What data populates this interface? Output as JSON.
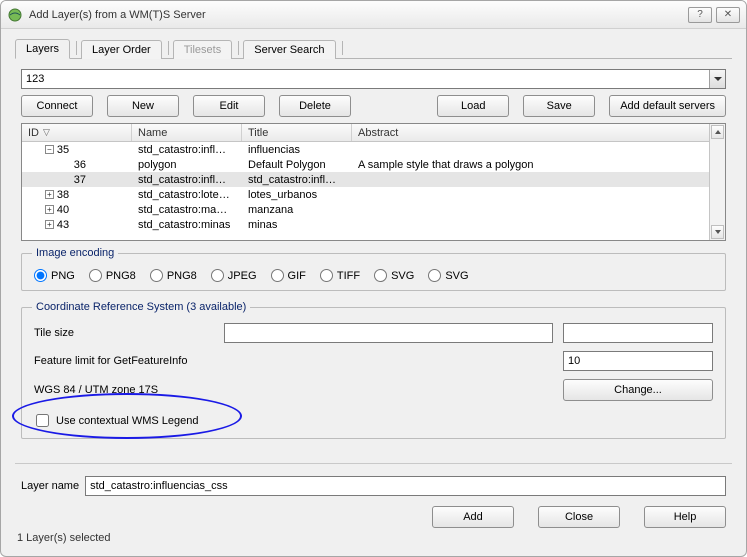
{
  "window": {
    "title": "Add Layer(s) from a WM(T)S Server"
  },
  "tabs": {
    "layers": "Layers",
    "layer_order": "Layer Order",
    "tilesets": "Tilesets",
    "server_search": "Server Search"
  },
  "server_combo": {
    "value": "123"
  },
  "buttons": {
    "connect": "Connect",
    "new": "New",
    "edit": "Edit",
    "delete": "Delete",
    "load": "Load",
    "save": "Save",
    "add_default": "Add default servers",
    "change": "Change...",
    "add": "Add",
    "close": "Close",
    "help": "Help"
  },
  "layer_table": {
    "headers": {
      "id": "ID",
      "name": "Name",
      "title": "Title",
      "abstract": "Abstract"
    },
    "rows": [
      {
        "id": "35",
        "indent": 1,
        "expander": "minus",
        "name": "std_catastro:infl…",
        "title": "influencias",
        "abstract": "",
        "selected": false
      },
      {
        "id": "36",
        "indent": 2,
        "expander": "",
        "name": "polygon",
        "title": "Default Polygon",
        "abstract": "A sample style that draws a polygon",
        "selected": false
      },
      {
        "id": "37",
        "indent": 2,
        "expander": "",
        "name": "std_catastro:infl…",
        "title": "std_catastro:infl…",
        "abstract": "",
        "selected": true
      },
      {
        "id": "38",
        "indent": 1,
        "expander": "plus",
        "name": "std_catastro:lote…",
        "title": "lotes_urbanos",
        "abstract": "",
        "selected": false
      },
      {
        "id": "40",
        "indent": 1,
        "expander": "plus",
        "name": "std_catastro:ma…",
        "title": "manzana",
        "abstract": "",
        "selected": false
      },
      {
        "id": "43",
        "indent": 1,
        "expander": "plus",
        "name": "std_catastro:minas",
        "title": "minas",
        "abstract": "",
        "selected": false
      }
    ]
  },
  "image_encoding": {
    "legend": "Image encoding",
    "options": [
      "PNG",
      "PNG8",
      "PNG8",
      "JPEG",
      "GIF",
      "TIFF",
      "SVG",
      "SVG"
    ],
    "selected_index": 0
  },
  "crs": {
    "legend": "Coordinate Reference System (3 available)",
    "tile_size_label": "Tile size",
    "tile_size_a": "",
    "tile_size_b": "",
    "feature_limit_label": "Feature limit for GetFeatureInfo",
    "feature_limit_value": "10",
    "crs_name": "WGS 84 / UTM zone 17S",
    "contextual_checkbox": "Use contextual WMS Legend",
    "contextual_checked": false
  },
  "layer_name": {
    "label": "Layer name",
    "value": "std_catastro:influencias_css"
  },
  "status": "1 Layer(s) selected"
}
